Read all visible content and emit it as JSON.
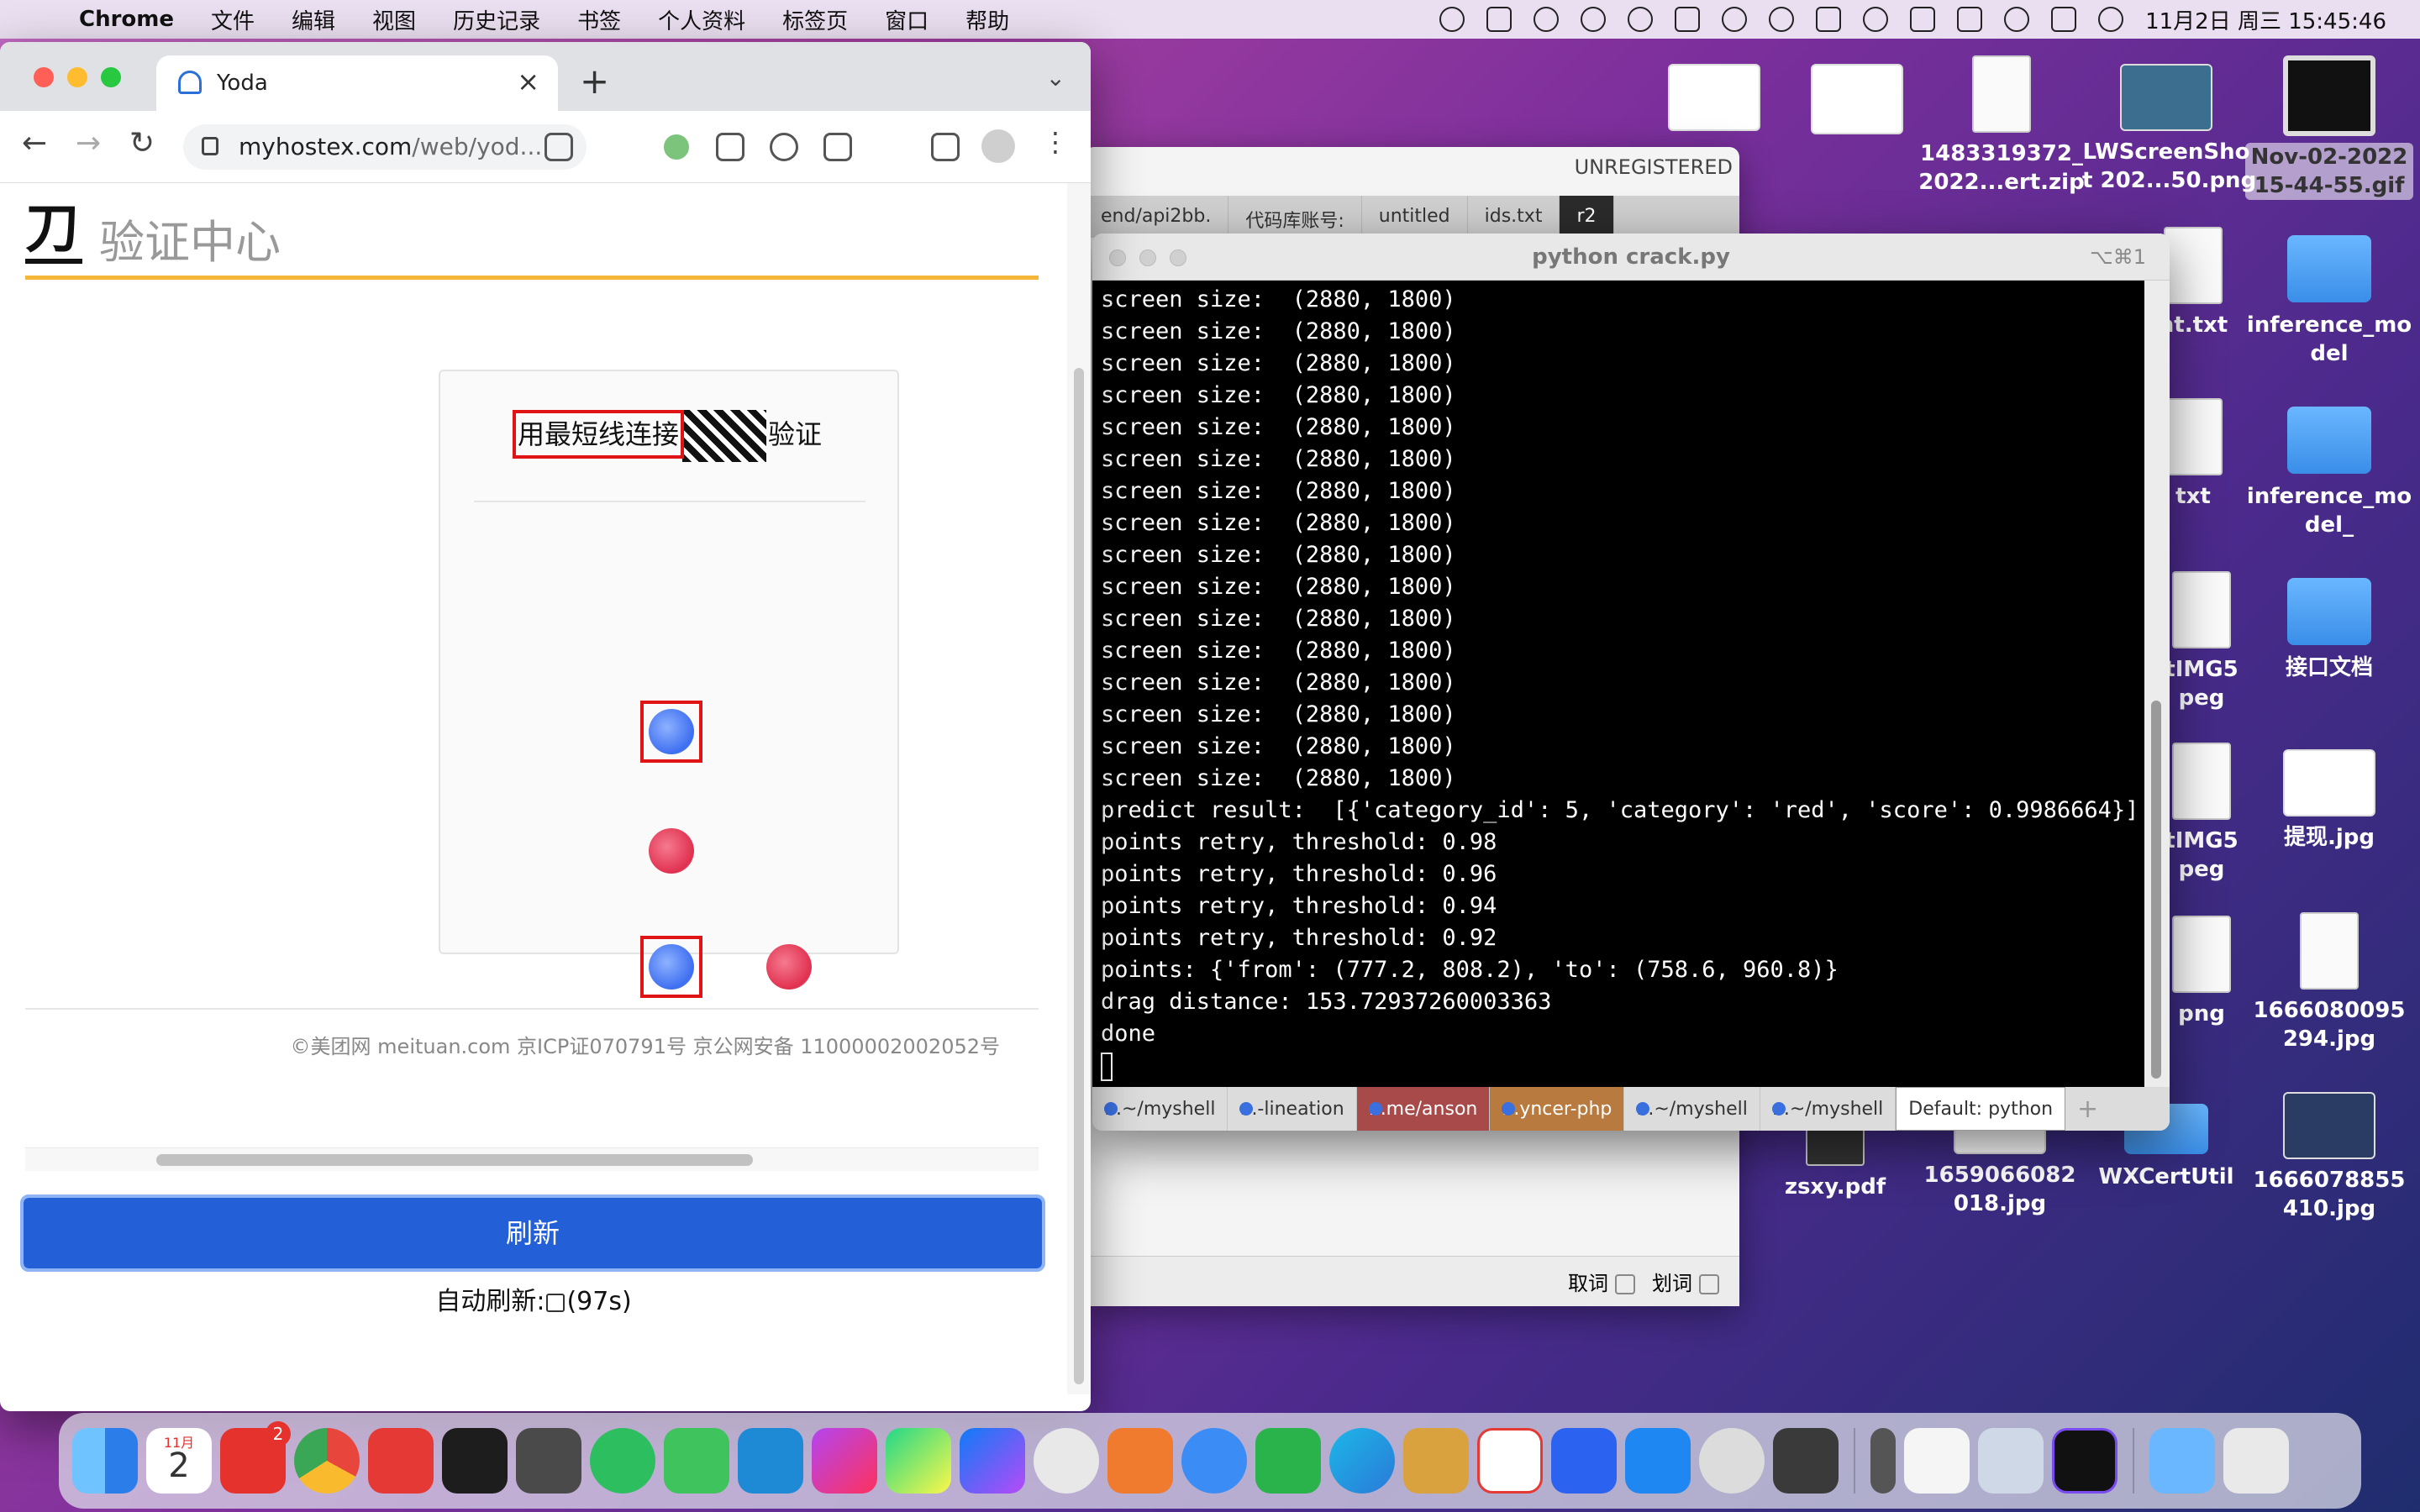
{
  "menubar": {
    "items": [
      "Chrome",
      "文件",
      "编辑",
      "视图",
      "历史记录",
      "书签",
      "个人资料",
      "标签页",
      "窗口",
      "帮助"
    ],
    "datetime": "11月2日 周三  15:45:46"
  },
  "desktop": {
    "icons": [
      {
        "label": "1483319372_\n2022...ert.zip"
      },
      {
        "label": "LWScreenSho\nt 202...50.png"
      },
      {
        "label": "Nov-02-2022\n15-44-55.gif"
      },
      {
        "label": "nt.txt"
      },
      {
        "label": "inference_mo\ndel"
      },
      {
        "label": "txt"
      },
      {
        "label": "inference_mo\ndel_"
      },
      {
        "label": "tIMG5\npeg"
      },
      {
        "label": "接口文档"
      },
      {
        "label": "tIMG5\npeg"
      },
      {
        "label": "提现.jpg"
      },
      {
        "label": "png"
      },
      {
        "label": "1666080095\n294.jpg"
      },
      {
        "label": "zsxy.pdf"
      },
      {
        "label": "1659066082\n018.jpg"
      },
      {
        "label": "WXCertUtil"
      },
      {
        "label": "1666078855\n410.jpg"
      }
    ]
  },
  "sublime": {
    "unregistered": "UNREGISTERED",
    "tabs": [
      "end/api2bb.",
      "代码库账号:",
      "untitled",
      "ids.txt",
      "r2"
    ],
    "bottom": {
      "opt1": "取词",
      "opt2": "划词"
    }
  },
  "terminal": {
    "title": "python crack.py",
    "shortcut": "⌥⌘1",
    "lines": [
      "screen size:  (2880, 1800)",
      "screen size:  (2880, 1800)",
      "screen size:  (2880, 1800)",
      "screen size:  (2880, 1800)",
      "screen size:  (2880, 1800)",
      "screen size:  (2880, 1800)",
      "screen size:  (2880, 1800)",
      "screen size:  (2880, 1800)",
      "screen size:  (2880, 1800)",
      "screen size:  (2880, 1800)",
      "screen size:  (2880, 1800)",
      "screen size:  (2880, 1800)",
      "screen size:  (2880, 1800)",
      "screen size:  (2880, 1800)",
      "screen size:  (2880, 1800)",
      "screen size:  (2880, 1800)",
      "predict result:  [{'category_id': 5, 'category': 'red', 'score': 0.9986664}]",
      "points retry, threshold: 0.98",
      "points retry, threshold: 0.96",
      "points retry, threshold: 0.94",
      "points retry, threshold: 0.92",
      "points: {'from': (777.2, 808.2), 'to': (758.6, 960.8)}",
      "drag distance: 153.72937260003363",
      "done"
    ],
    "tabs": [
      "...~/myshell",
      "...-lineation",
      "...me/anson",
      "...yncer-php",
      "...~/myshell",
      "...~/myshell",
      "Default: python"
    ]
  },
  "chrome": {
    "tab_title": "Yoda",
    "url_host": "myhostex.com",
    "url_path": "/web/yod...",
    "page": {
      "logo_glyph": "刀",
      "title": "验证中心",
      "captcha": {
        "prompt_boxed": "用最短线连接",
        "prompt_tail": "验证"
      },
      "footer": "©美团网 meituan.com 京ICP证070791号 京公网安备 11000002002052号",
      "refresh_label": "刷新",
      "auto_refresh_prefix": "自动刷新:",
      "auto_refresh_suffix": "(97s)"
    }
  },
  "dock": {
    "calendar_month": "11月",
    "calendar_day": "2",
    "badge_count": "2",
    "apps": [
      "finder",
      "calendar",
      "netease",
      "chrome",
      "youdao",
      "terminal",
      "sublime",
      "evernote",
      "wechat",
      "vscode",
      "phpstorm",
      "pycharm",
      "goland",
      "preview",
      "sketch",
      "lark",
      "screens",
      "edge",
      "transmit",
      "wps",
      "feishu",
      "xcode-tools",
      "terminal-alt",
      "calculator",
      "separator",
      "pencil",
      "textedit",
      "preview-img",
      "screenflow",
      "downloads",
      "trash"
    ]
  }
}
